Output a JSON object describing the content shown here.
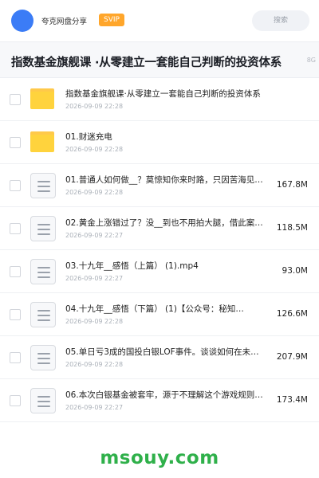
{
  "header": {
    "user_name": "夸克网盘分享",
    "badge": "SVIP",
    "search_placeholder": "搜索"
  },
  "title_bar": {
    "title": "指数基金旗舰课 ·从零建立一套能自己判断的投资体系",
    "total_size": "8G"
  },
  "files": [
    {
      "type": "folder",
      "name": "指数基金旗舰课·从零建立一套能自己判断的投资体系",
      "date": "2026-09-09 22:28",
      "size": ""
    },
    {
      "type": "folder",
      "name": "01.财迷充电",
      "date": "2026-09-09 22:28",
      "size": ""
    },
    {
      "type": "file",
      "name": "01.普通人如何做__？莫惊知你来时路，只因苦海见…",
      "date": "2026-09-09 22:28",
      "size": "167.8M"
    },
    {
      "type": "file",
      "name": "02.黄金上涨错过了？没__到也不用拍大腿，借此案…",
      "date": "2026-09-09 22:27",
      "size": "118.5M"
    },
    {
      "type": "file",
      "name": "03.十九年__感悟（上篇） (1).mp4",
      "date": "2026-09-09 22:27",
      "size": "93.0M"
    },
    {
      "type": "file",
      "name": "04.十九年__感悟（下篇） (1)【公众号：秘知…",
      "date": "2026-09-09 22:28",
      "size": "126.6M"
    },
    {
      "type": "file",
      "name": "05.单日亏3成的国投白银LOF事件。谈谈如何在未…",
      "date": "2026-09-09 22:28",
      "size": "207.9M"
    },
    {
      "type": "file",
      "name": "06.本次白银基金被套牢，源于不理解这个游戏规则。…",
      "date": "2026-09-09 22:27",
      "size": "173.4M"
    }
  ],
  "watermark": "msouy.com"
}
